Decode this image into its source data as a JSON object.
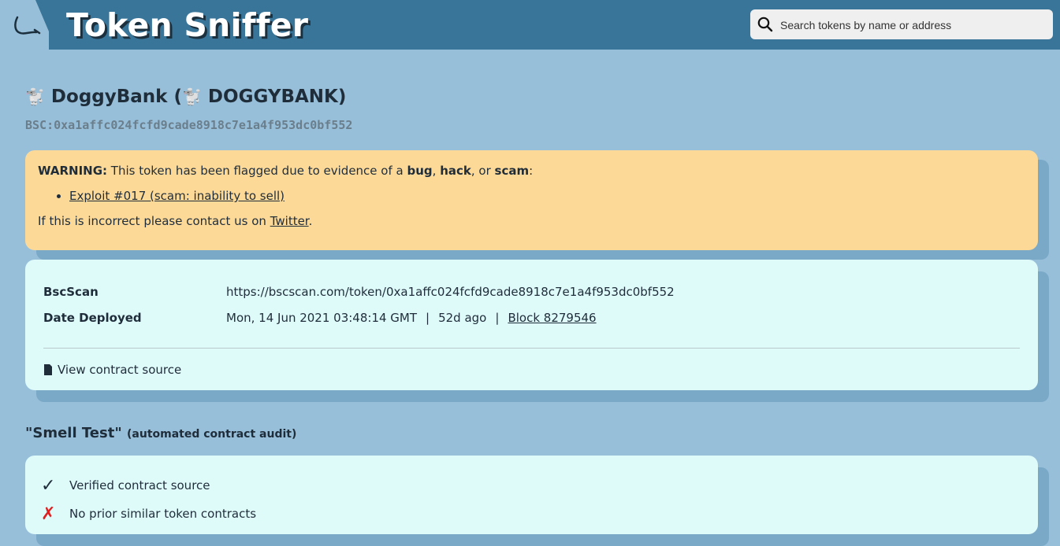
{
  "header": {
    "brand": "Token Sniffer",
    "search_placeholder": "Search tokens by name or address"
  },
  "token": {
    "emoji": "🐩",
    "name": "DoggyBank",
    "symbol": "DOGGYBANK",
    "address": "BSC:0xa1affc024fcfd9cade8918c7e1a4f953dc0bf552"
  },
  "warning": {
    "label": "WARNING:",
    "text_before": " This token has been flagged due to evidence of a ",
    "bug": "bug",
    "comma": ", ",
    "hack": "hack",
    "or": ", or ",
    "scam": "scam",
    "colon": ":",
    "exploit_link": "Exploit #017 (scam: inability to sell)",
    "footer_before": "If this is incorrect please contact us on ",
    "twitter_link": "Twitter",
    "footer_after": "."
  },
  "info": {
    "bscscan_label": "BscScan",
    "bscscan_url": "https://bscscan.com/token/0xa1affc024fcfd9cade8918c7e1a4f953dc0bf552",
    "deployed_label": "Date Deployed",
    "deployed_date": "Mon, 14 Jun 2021 03:48:14 GMT",
    "separator": "|",
    "age": "52d ago",
    "block_link": "Block 8279546",
    "view_source": "View contract source"
  },
  "smell_test": {
    "title": "\"Smell Test\"",
    "subtitle": "(automated contract audit)",
    "items": [
      {
        "status": "pass",
        "mark": "✓",
        "label": "Verified contract source"
      },
      {
        "status": "fail",
        "mark": "✗",
        "label": "No prior similar token contracts"
      }
    ]
  }
}
